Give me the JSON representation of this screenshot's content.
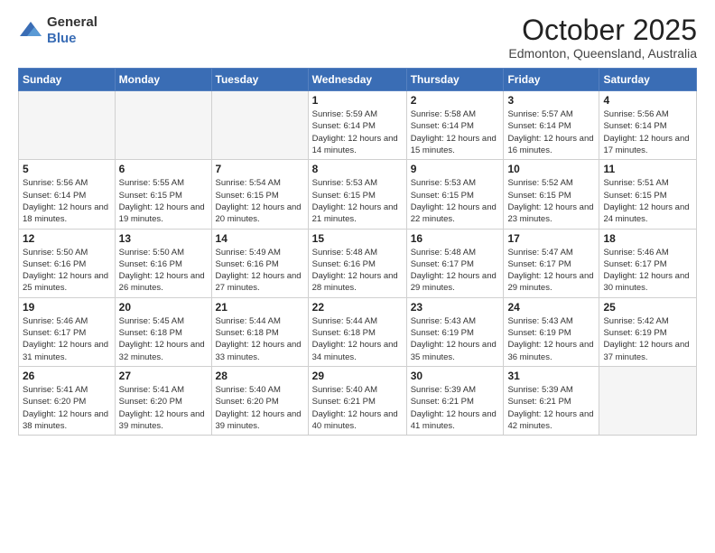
{
  "logo": {
    "general": "General",
    "blue": "Blue"
  },
  "header": {
    "month": "October 2025",
    "location": "Edmonton, Queensland, Australia"
  },
  "weekdays": [
    "Sunday",
    "Monday",
    "Tuesday",
    "Wednesday",
    "Thursday",
    "Friday",
    "Saturday"
  ],
  "weeks": [
    [
      {
        "day": "",
        "info": ""
      },
      {
        "day": "",
        "info": ""
      },
      {
        "day": "",
        "info": ""
      },
      {
        "day": "1",
        "info": "Sunrise: 5:59 AM\nSunset: 6:14 PM\nDaylight: 12 hours\nand 14 minutes."
      },
      {
        "day": "2",
        "info": "Sunrise: 5:58 AM\nSunset: 6:14 PM\nDaylight: 12 hours\nand 15 minutes."
      },
      {
        "day": "3",
        "info": "Sunrise: 5:57 AM\nSunset: 6:14 PM\nDaylight: 12 hours\nand 16 minutes."
      },
      {
        "day": "4",
        "info": "Sunrise: 5:56 AM\nSunset: 6:14 PM\nDaylight: 12 hours\nand 17 minutes."
      }
    ],
    [
      {
        "day": "5",
        "info": "Sunrise: 5:56 AM\nSunset: 6:14 PM\nDaylight: 12 hours\nand 18 minutes."
      },
      {
        "day": "6",
        "info": "Sunrise: 5:55 AM\nSunset: 6:15 PM\nDaylight: 12 hours\nand 19 minutes."
      },
      {
        "day": "7",
        "info": "Sunrise: 5:54 AM\nSunset: 6:15 PM\nDaylight: 12 hours\nand 20 minutes."
      },
      {
        "day": "8",
        "info": "Sunrise: 5:53 AM\nSunset: 6:15 PM\nDaylight: 12 hours\nand 21 minutes."
      },
      {
        "day": "9",
        "info": "Sunrise: 5:53 AM\nSunset: 6:15 PM\nDaylight: 12 hours\nand 22 minutes."
      },
      {
        "day": "10",
        "info": "Sunrise: 5:52 AM\nSunset: 6:15 PM\nDaylight: 12 hours\nand 23 minutes."
      },
      {
        "day": "11",
        "info": "Sunrise: 5:51 AM\nSunset: 6:15 PM\nDaylight: 12 hours\nand 24 minutes."
      }
    ],
    [
      {
        "day": "12",
        "info": "Sunrise: 5:50 AM\nSunset: 6:16 PM\nDaylight: 12 hours\nand 25 minutes."
      },
      {
        "day": "13",
        "info": "Sunrise: 5:50 AM\nSunset: 6:16 PM\nDaylight: 12 hours\nand 26 minutes."
      },
      {
        "day": "14",
        "info": "Sunrise: 5:49 AM\nSunset: 6:16 PM\nDaylight: 12 hours\nand 27 minutes."
      },
      {
        "day": "15",
        "info": "Sunrise: 5:48 AM\nSunset: 6:16 PM\nDaylight: 12 hours\nand 28 minutes."
      },
      {
        "day": "16",
        "info": "Sunrise: 5:48 AM\nSunset: 6:17 PM\nDaylight: 12 hours\nand 29 minutes."
      },
      {
        "day": "17",
        "info": "Sunrise: 5:47 AM\nSunset: 6:17 PM\nDaylight: 12 hours\nand 29 minutes."
      },
      {
        "day": "18",
        "info": "Sunrise: 5:46 AM\nSunset: 6:17 PM\nDaylight: 12 hours\nand 30 minutes."
      }
    ],
    [
      {
        "day": "19",
        "info": "Sunrise: 5:46 AM\nSunset: 6:17 PM\nDaylight: 12 hours\nand 31 minutes."
      },
      {
        "day": "20",
        "info": "Sunrise: 5:45 AM\nSunset: 6:18 PM\nDaylight: 12 hours\nand 32 minutes."
      },
      {
        "day": "21",
        "info": "Sunrise: 5:44 AM\nSunset: 6:18 PM\nDaylight: 12 hours\nand 33 minutes."
      },
      {
        "day": "22",
        "info": "Sunrise: 5:44 AM\nSunset: 6:18 PM\nDaylight: 12 hours\nand 34 minutes."
      },
      {
        "day": "23",
        "info": "Sunrise: 5:43 AM\nSunset: 6:19 PM\nDaylight: 12 hours\nand 35 minutes."
      },
      {
        "day": "24",
        "info": "Sunrise: 5:43 AM\nSunset: 6:19 PM\nDaylight: 12 hours\nand 36 minutes."
      },
      {
        "day": "25",
        "info": "Sunrise: 5:42 AM\nSunset: 6:19 PM\nDaylight: 12 hours\nand 37 minutes."
      }
    ],
    [
      {
        "day": "26",
        "info": "Sunrise: 5:41 AM\nSunset: 6:20 PM\nDaylight: 12 hours\nand 38 minutes."
      },
      {
        "day": "27",
        "info": "Sunrise: 5:41 AM\nSunset: 6:20 PM\nDaylight: 12 hours\nand 39 minutes."
      },
      {
        "day": "28",
        "info": "Sunrise: 5:40 AM\nSunset: 6:20 PM\nDaylight: 12 hours\nand 39 minutes."
      },
      {
        "day": "29",
        "info": "Sunrise: 5:40 AM\nSunset: 6:21 PM\nDaylight: 12 hours\nand 40 minutes."
      },
      {
        "day": "30",
        "info": "Sunrise: 5:39 AM\nSunset: 6:21 PM\nDaylight: 12 hours\nand 41 minutes."
      },
      {
        "day": "31",
        "info": "Sunrise: 5:39 AM\nSunset: 6:21 PM\nDaylight: 12 hours\nand 42 minutes."
      },
      {
        "day": "",
        "info": ""
      }
    ]
  ]
}
